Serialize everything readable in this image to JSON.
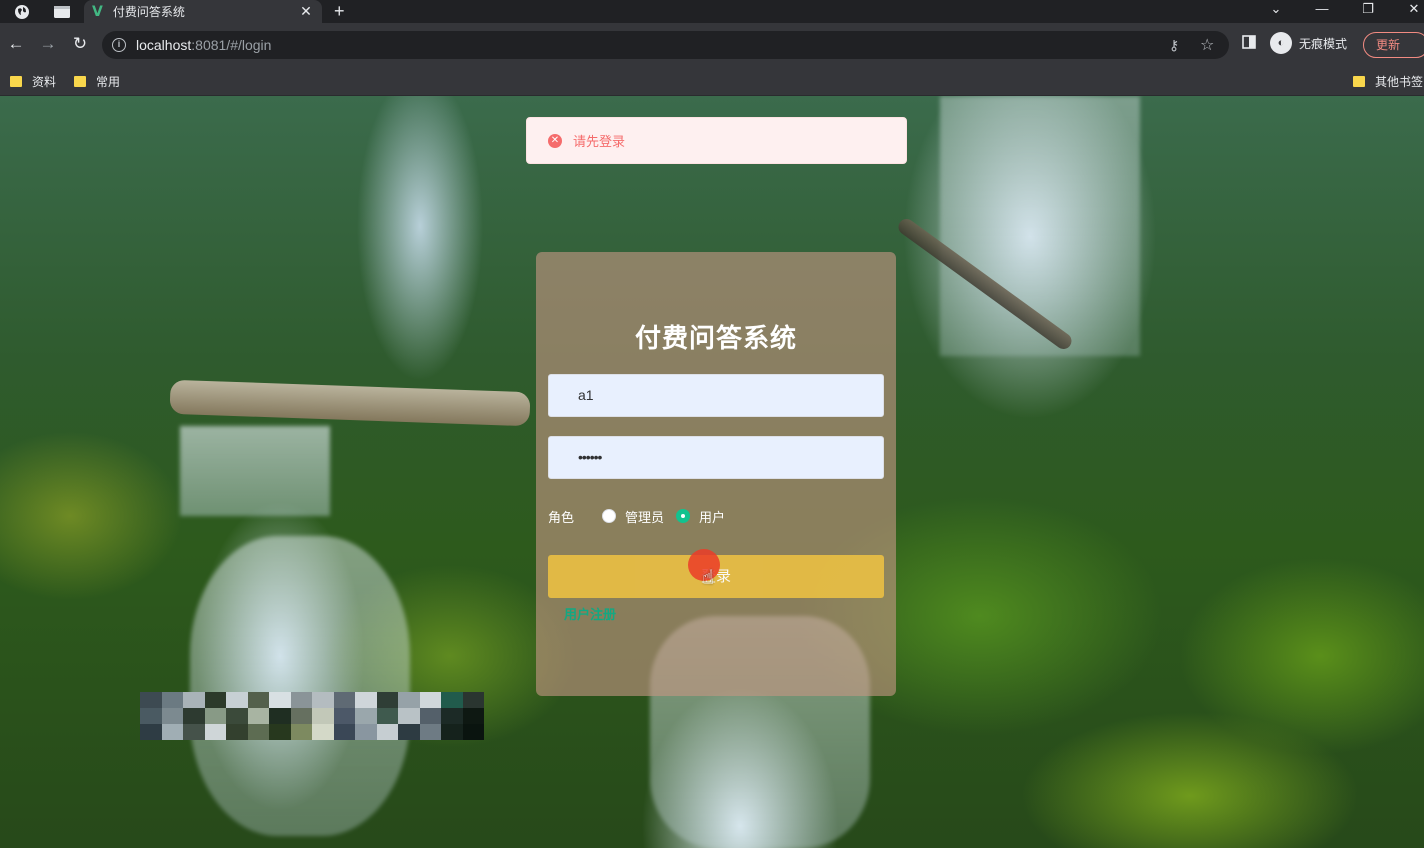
{
  "browser": {
    "tab_title": "付费问答系统",
    "tab_close": "✕",
    "new_tab": "+",
    "url_host": "localhost",
    "url_rest": ":8081/#/login",
    "incognito_label": "无痕模式",
    "update_label": "更新",
    "bookmarks": [
      {
        "label": "资料"
      },
      {
        "label": "常用"
      }
    ],
    "other_bookmarks": "其他书签"
  },
  "message": {
    "type": "error",
    "text": "请先登录"
  },
  "login": {
    "title": "付费问答系统",
    "username_value": "a1",
    "password_value": "••••••",
    "role_label": "角色",
    "roles": [
      {
        "label": "管理员",
        "checked": false
      },
      {
        "label": "用户",
        "checked": true
      }
    ],
    "login_button": "登录",
    "register_link": "用户注册"
  },
  "colors": {
    "accent_green": "#13c28f",
    "button_yellow": "#e6bd45",
    "error_red": "#f56c6c"
  }
}
